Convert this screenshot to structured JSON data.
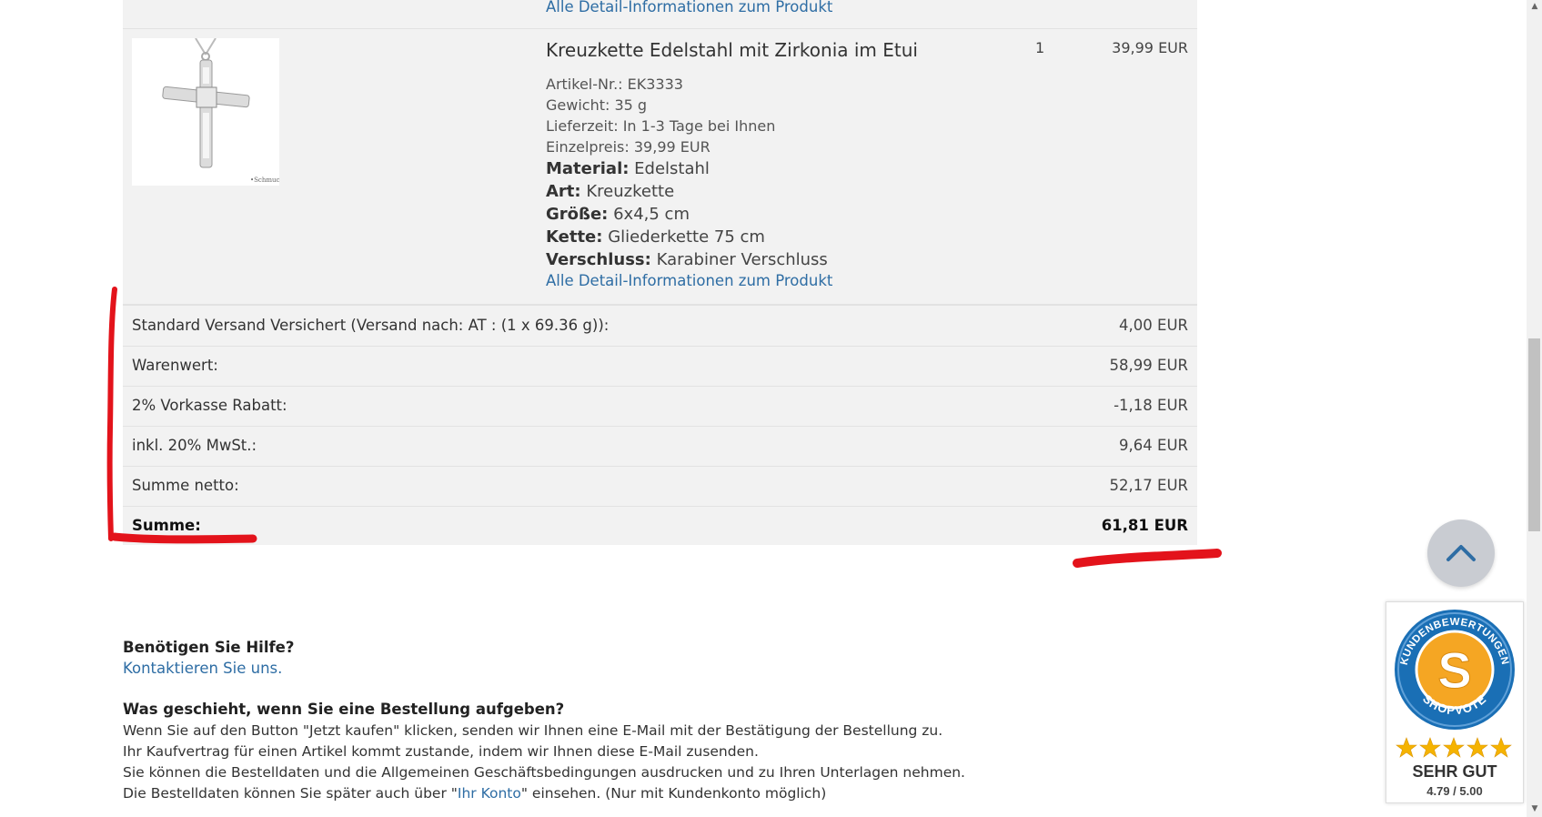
{
  "previous_product": {
    "detail_link": "Alle Detail-Informationen zum Produkt"
  },
  "product": {
    "title": "Kreuzkette Edelstahl mit Zirkonia im Etui",
    "quantity": "1",
    "price": "39,99 EUR",
    "meta": [
      "Artikel-Nr.: EK3333",
      "Gewicht: 35 g",
      "Lieferzeit: In 1-3 Tage bei Ihnen",
      "Einzelpreis: 39,99 EUR"
    ],
    "attributes": [
      {
        "label": "Material:",
        "value": "Edelstahl"
      },
      {
        "label": "Art:",
        "value": "Kreuzkette"
      },
      {
        "label": "Größe:",
        "value": "6x4,5 cm"
      },
      {
        "label": "Kette:",
        "value": "Gliederkette 75 cm"
      },
      {
        "label": "Verschluss:",
        "value": "Karabiner Verschluss"
      }
    ],
    "detail_link": "Alle Detail-Informationen zum Produkt"
  },
  "summary": [
    {
      "label": "Standard Versand Versichert (Versand nach: AT : (1 x 69.36 g)):",
      "value": "4,00 EUR"
    },
    {
      "label": "Warenwert:",
      "value": "58,99 EUR"
    },
    {
      "label": "2% Vorkasse Rabatt:",
      "value": "-1,18 EUR"
    },
    {
      "label": "inkl. 20% MwSt.:",
      "value": "9,64 EUR"
    },
    {
      "label": "Summe netto:",
      "value": "52,17 EUR"
    },
    {
      "label": "Summe:",
      "value": "61,81 EUR"
    }
  ],
  "help": {
    "title": "Benötigen Sie Hilfe?",
    "link": "Kontaktieren Sie uns."
  },
  "faq": {
    "title": "Was geschieht, wenn Sie eine Bestellung aufgeben?",
    "line1": "Wenn Sie auf den Button \"Jetzt kaufen\" klicken, senden wir Ihnen eine E-Mail mit der Bestätigung der Bestellung zu.",
    "line2": "Ihr Kaufvertrag für einen Artikel kommt zustande, indem wir Ihnen diese E-Mail zusenden.",
    "line3": "Sie können die Bestelldaten und die Allgemeinen Geschäftsbedingungen ausdrucken und zu Ihren Unterlagen nehmen.",
    "line4_before": "Die Bestelldaten können Sie später auch über \"",
    "line4_link": "Ihr Konto",
    "line4_after": "\" einsehen. (Nur mit Kundenkonto möglich)"
  },
  "badge": {
    "ring_top": "KUNDENBEWERTUNGEN",
    "ring_bottom": "SHOPVOTE",
    "letter": "S",
    "stars": 5,
    "rating_label": "SEHR GUT",
    "score": "4.79 / 5.00"
  },
  "colors": {
    "link": "#2e6da4",
    "panel": "#f2f2f2",
    "annotation": "#e3131b",
    "badge_blue": "#1a6fb5",
    "badge_orange": "#f5a623"
  },
  "icons": {
    "to_top": "chevron-up-icon",
    "badge": "shopvote-seal-icon",
    "stars": "star-icon"
  }
}
